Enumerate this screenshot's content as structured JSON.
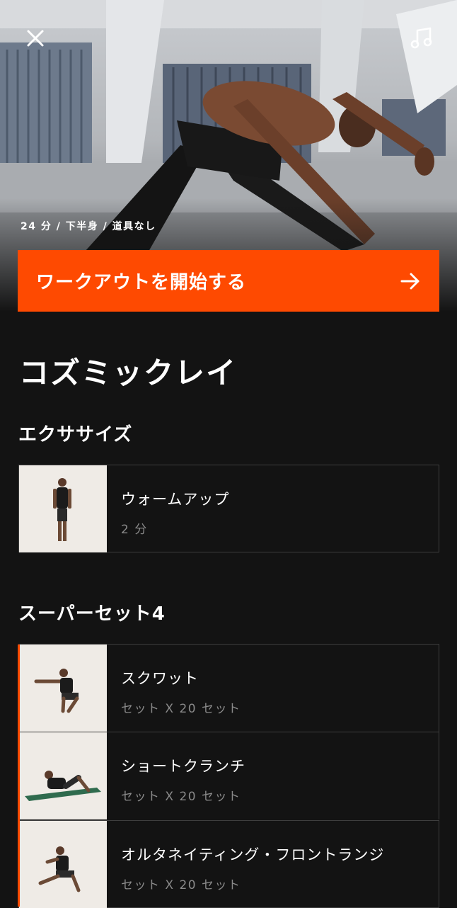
{
  "header": {
    "close_icon": "close-icon",
    "music_icon": "music-note-icon",
    "meta": "24 分 / 下半身 / 道具なし"
  },
  "start_button": {
    "label": "ワークアウトを開始する",
    "icon": "arrow-right-icon",
    "color": "#fe4a01"
  },
  "workout": {
    "title": "コズミックレイ"
  },
  "sections": {
    "exercises": {
      "title": "エクササイズ",
      "items": [
        {
          "name": "ウォームアップ",
          "detail": "2 分"
        }
      ]
    },
    "superset": {
      "title": "スーパーセット4",
      "items": [
        {
          "name": "スクワット",
          "detail": "セット X 20 セット"
        },
        {
          "name": "ショートクランチ",
          "detail": "セット X 20 セット"
        },
        {
          "name": "オルタネイティング・フロントランジ",
          "detail": "セット X 20 セット"
        }
      ]
    }
  }
}
